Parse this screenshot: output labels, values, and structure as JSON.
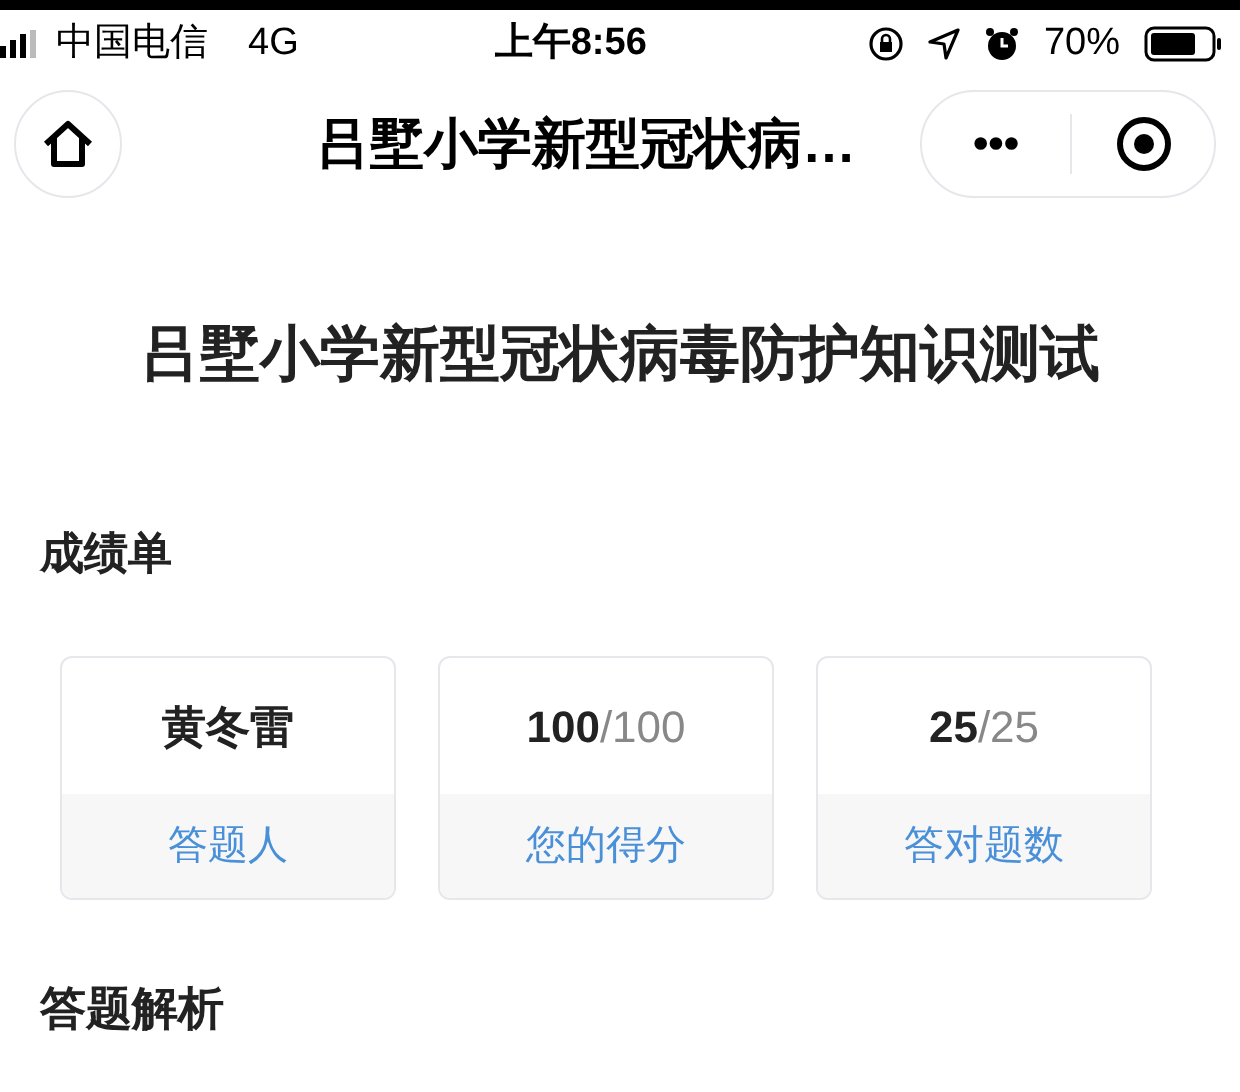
{
  "status_bar": {
    "carrier": "中国电信",
    "network": "4G",
    "time": "上午8:56",
    "battery_percent": "70%"
  },
  "nav_bar": {
    "title": "吕墅小学新型冠状病…",
    "more": "•••"
  },
  "page_title": "吕墅小学新型冠状病毒防护知识测试",
  "report": {
    "heading": "成绩单",
    "cards": [
      {
        "kind": "text",
        "value": "黄冬雷",
        "label": "答题人"
      },
      {
        "kind": "fraction",
        "value": "100",
        "total": "/100",
        "label": "您的得分"
      },
      {
        "kind": "fraction",
        "value": "25",
        "total": "/25",
        "label": "答对题数"
      }
    ]
  },
  "analysis": {
    "heading": "答题解析"
  }
}
